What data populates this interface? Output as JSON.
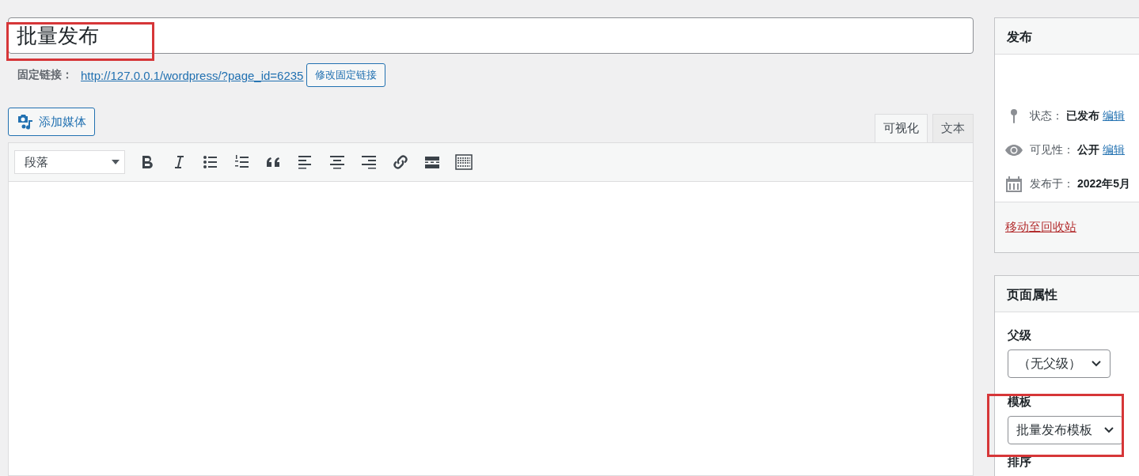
{
  "title_field": {
    "value": "批量发布"
  },
  "permalink": {
    "label": "固定链接：",
    "url": "http://127.0.0.1/wordpress/?page_id=6235",
    "button": "修改固定链接"
  },
  "add_media": {
    "label": "添加媒体"
  },
  "editor_tabs": [
    {
      "label": "可视化",
      "selected": true
    },
    {
      "label": "文本",
      "selected": false
    }
  ],
  "toolbar": {
    "format": "段落"
  },
  "publish_box": {
    "title": "发布",
    "rows": [
      {
        "kind": "status",
        "label": "状态：",
        "value": "已发布",
        "link": "编辑"
      },
      {
        "kind": "visibility",
        "label": "可见性：",
        "value": "公开",
        "link": "编辑"
      },
      {
        "kind": "date",
        "label": "发布于：",
        "value": "2022年5月"
      }
    ],
    "trash": "移动至回收站"
  },
  "page_attributes": {
    "title": "页面属性",
    "parent_label": "父级",
    "parent": "（无父级）",
    "template_label": "模板",
    "template": "批量发布模板",
    "order_label": "排序"
  }
}
